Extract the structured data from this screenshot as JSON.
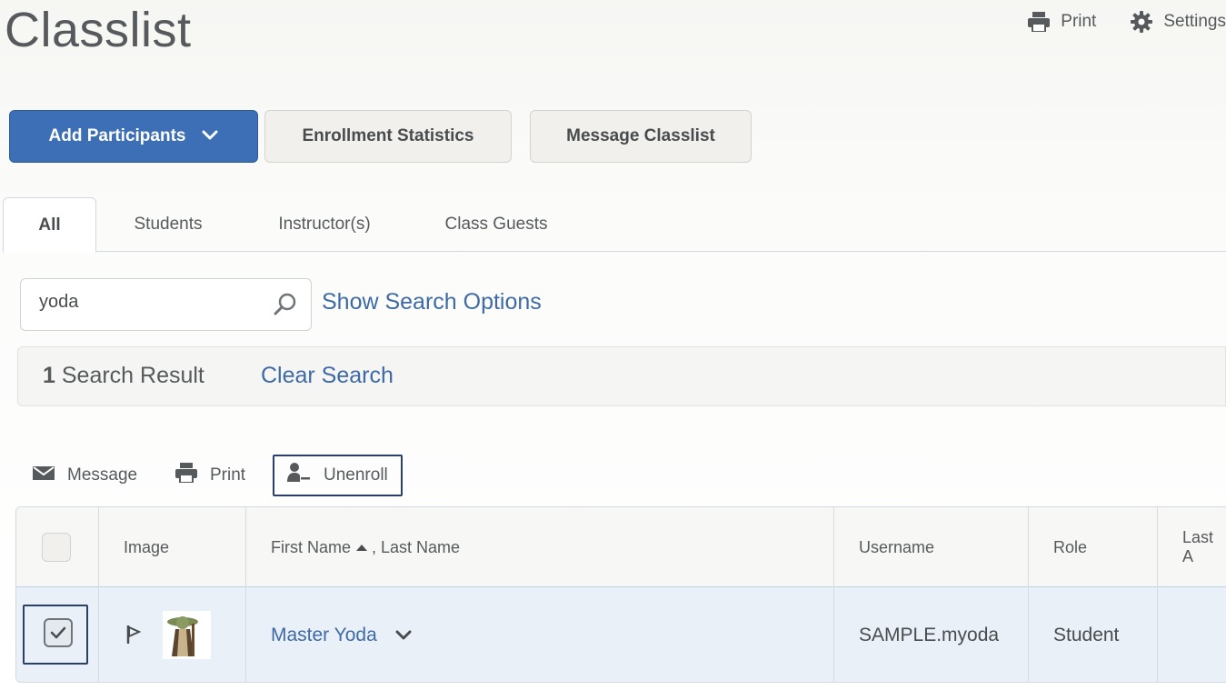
{
  "page": {
    "title": "Classlist"
  },
  "top_actions": {
    "print_label": "Print",
    "settings_label": "Settings"
  },
  "toolbar": {
    "add_participants_label": "Add Participants",
    "enrollment_stats_label": "Enrollment Statistics",
    "message_classlist_label": "Message Classlist"
  },
  "tabs": [
    {
      "label": "All",
      "active": true
    },
    {
      "label": "Students",
      "active": false
    },
    {
      "label": "Instructor(s)",
      "active": false
    },
    {
      "label": "Class Guests",
      "active": false
    }
  ],
  "search": {
    "value": "yoda",
    "show_options_label": "Show Search Options"
  },
  "results": {
    "count": "1",
    "count_label": "Search Result",
    "clear_label": "Clear Search"
  },
  "bulk_actions": {
    "message_label": "Message",
    "print_label": "Print",
    "unenroll_label": "Unenroll"
  },
  "table": {
    "headers": {
      "image": "Image",
      "first_name": "First Name",
      "last_name": ", Last Name",
      "username": "Username",
      "role": "Role",
      "last_access": "Last A"
    },
    "rows": [
      {
        "name": "Master Yoda",
        "username": "SAMPLE.myoda",
        "role": "Student",
        "selected": true
      }
    ]
  },
  "colors": {
    "accent": "#3d6fb6",
    "link": "#3e6aa5",
    "highlight_border": "#2b3f6b",
    "row_selected_bg": "#eaf0f7"
  }
}
